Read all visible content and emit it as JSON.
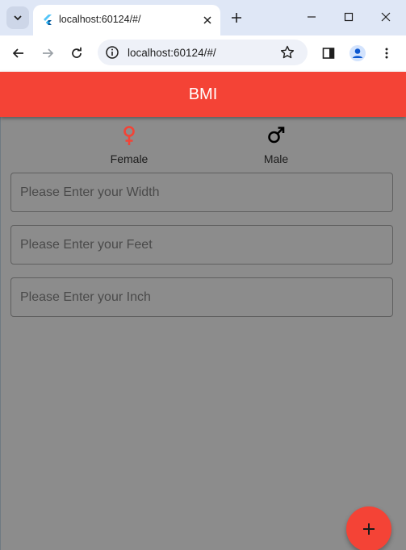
{
  "browser": {
    "tab": {
      "title": "localhost:60124/#/"
    },
    "address_bar": {
      "url": "localhost:60124/#/"
    }
  },
  "app": {
    "title": "BMI",
    "gender": {
      "female": {
        "label": "Female",
        "icon": "female-icon",
        "color": "#f44336",
        "selected": true
      },
      "male": {
        "label": "Male",
        "icon": "male-icon",
        "color": "#000000",
        "selected": false
      }
    },
    "fields": {
      "width": {
        "placeholder": "Please Enter your Width",
        "value": ""
      },
      "feet": {
        "placeholder": "Please Enter your Feet",
        "value": ""
      },
      "inch": {
        "placeholder": "Please Enter your Inch",
        "value": ""
      }
    },
    "fab": {
      "icon": "add-icon"
    },
    "colors": {
      "primary": "#f44336",
      "background": "#8c8c8c"
    }
  }
}
